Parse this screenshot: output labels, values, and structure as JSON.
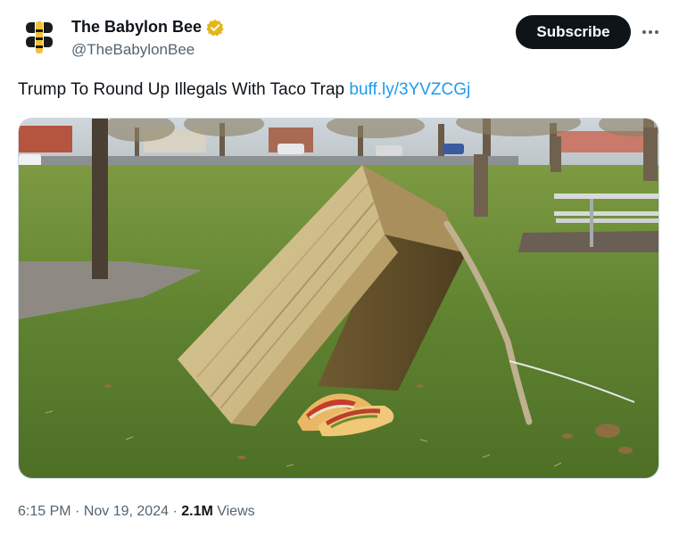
{
  "author": {
    "name": "The Babylon Bee",
    "handle": "@TheBabylonBee",
    "avatar_icon": "bee-logo",
    "verified_icon": "gold-verified-badge",
    "verified_color": "#e2b719"
  },
  "actions": {
    "subscribe_label": "Subscribe",
    "more_icon": "more-horizontal-icon"
  },
  "tweet": {
    "text": "Trump To Round Up Illegals With Taco Trap ",
    "link": "buff.ly/3YVZCGj"
  },
  "media": {
    "alt": "Wooden crate propped up by a stick over tacos on a grassy park field"
  },
  "meta": {
    "time": "6:15 PM",
    "sep1": " · ",
    "date": "Nov 19, 2024",
    "sep2": " · ",
    "views_count": "2.1M",
    "views_label": " Views"
  },
  "colors": {
    "accent": "#1d9bf0",
    "text_primary": "#0f1419",
    "text_secondary": "#536471"
  }
}
